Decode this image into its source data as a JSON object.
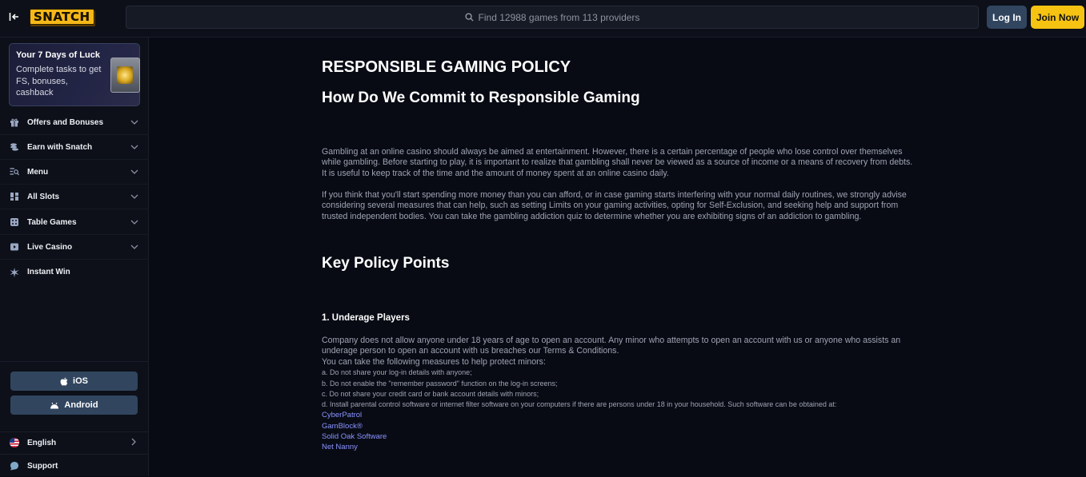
{
  "header": {
    "logo_text": "SNATCH",
    "search_placeholder": "Find 12988 games from 113 providers",
    "login_label": "Log In",
    "join_label": "Join Now"
  },
  "sidebar": {
    "promo": {
      "title": "Your 7 Days of Luck",
      "text": "Complete tasks to get FS, bonuses, cashback"
    },
    "items": [
      {
        "label": "Offers and Bonuses",
        "icon": "gift-icon"
      },
      {
        "label": "Earn with Snatch",
        "icon": "coins-icon"
      },
      {
        "label": "Menu",
        "icon": "menu-search-icon"
      },
      {
        "label": "All Slots",
        "icon": "grid-icon"
      },
      {
        "label": "Table Games",
        "icon": "dice-icon"
      },
      {
        "label": "Live Casino",
        "icon": "play-icon"
      },
      {
        "label": "Instant Win",
        "icon": "sparkle-icon"
      }
    ],
    "apps": {
      "ios": "iOS",
      "android": "Android"
    },
    "language": "English",
    "support": "Support"
  },
  "content": {
    "title": "RESPONSIBLE GAMING POLICY",
    "subtitle": "How Do We Commit to Responsible Gaming",
    "para1": "Gambling at an online casino should always be aimed at entertainment. However, there is a certain percentage of people who lose control over themselves while gambling. Before starting to play, it is important to realize that gambling shall never be viewed as a source of income or a means of recovery from debts. It is useful to keep track of the time and the amount of money spent at an online casino daily.",
    "para2": "If you think that you'll start spending more money than you can afford, or in case gaming starts interfering with your normal daily routines, we strongly advise considering several measures that can help, such as setting Limits on your gaming activities, opting for Self-Exclusion, and seeking help and support from trusted independent bodies. You can take the gambling addiction quiz to determine whether you are exhibiting signs of an addiction to gambling.",
    "key_heading": "Key Policy Points",
    "section1_heading": "1. Underage Players",
    "section1_para": "Company does not allow anyone under 18 years of age to open an account. Any minor who attempts to open an account with us or anyone who assists an underage person to open an account with us breaches our Terms & Conditions.",
    "section1_intro": "You can take the following measures to help protect minors:",
    "measures": [
      "a. Do not share your log-in details with anyone;",
      "b. Do not enable the \"remember password\" function on the log-in screens;",
      "c. Do not share your credit card or bank account details with minors;",
      "d. Install parental control software or internet filter software on your computers if there are persons under 18 in your household. Such software can be obtained at:"
    ],
    "links": [
      "CyberPatrol",
      "GamBlock®",
      "Solid Oak Software",
      "Net Nanny"
    ]
  }
}
